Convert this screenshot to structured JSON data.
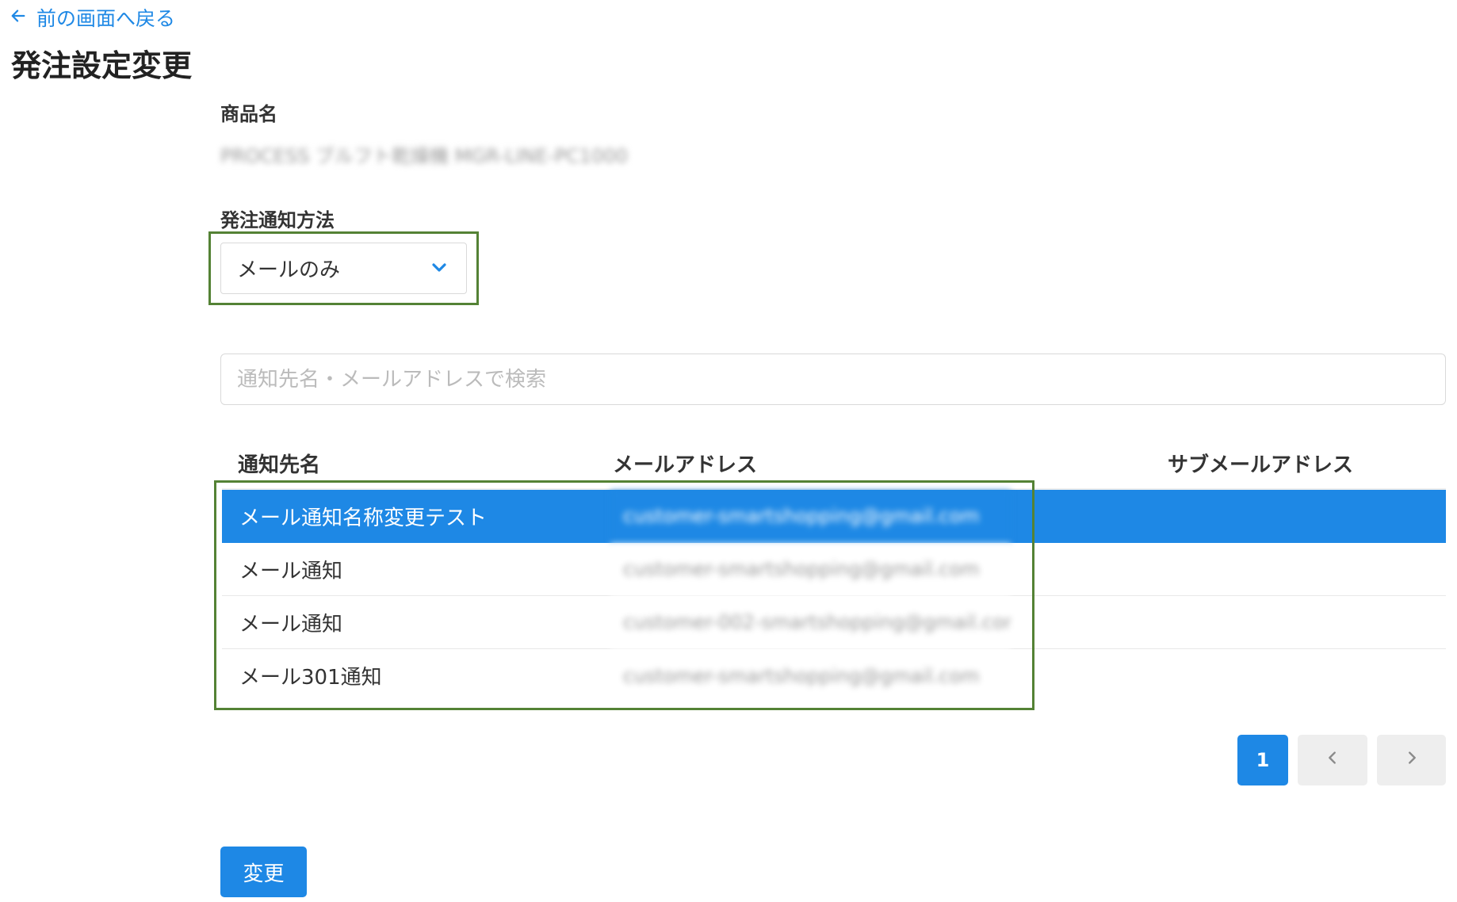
{
  "nav": {
    "back_label": "前の画面へ戻る"
  },
  "page": {
    "title": "発注設定変更"
  },
  "product": {
    "label": "商品名",
    "value": "PROCESS ブルフト乾燥機 MGR-LINE-PC1000"
  },
  "notification": {
    "label": "発注通知方法",
    "selected": "メールのみ"
  },
  "search": {
    "placeholder": "通知先名・メールアドレスで検索"
  },
  "table": {
    "headers": {
      "name": "通知先名",
      "email": "メールアドレス",
      "sub_email": "サブメールアドレス"
    },
    "rows": [
      {
        "name": "メール通知名称変更テスト",
        "email": "customer-smartshopping@gmail.com",
        "sub_email": "",
        "selected": true
      },
      {
        "name": "メール通知",
        "email": "customer-smartshopping@gmail.com",
        "sub_email": "",
        "selected": false
      },
      {
        "name": "メール通知",
        "email": "customer-002-smartshopping@gmail.com",
        "sub_email": "",
        "selected": false
      },
      {
        "name": "メール301通知",
        "email": "customer-smartshopping@gmail.com",
        "sub_email": "",
        "selected": false
      }
    ]
  },
  "pagination": {
    "current_page": "1"
  },
  "actions": {
    "submit_label": "変更"
  },
  "colors": {
    "accent": "#1e88e5",
    "highlight_border": "#548235"
  },
  "icons": {
    "back": "arrow-left-icon",
    "dropdown": "chevron-down-icon",
    "prev": "chevron-left-icon",
    "next": "chevron-right-icon"
  }
}
